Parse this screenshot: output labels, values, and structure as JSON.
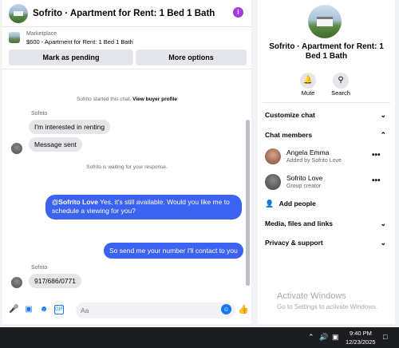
{
  "chat": {
    "title": "Sofrito · Apartment for Rent: 1 Bed 1 Bath",
    "info_icon": "i",
    "listing": {
      "label": "Marketplace",
      "price_title": "$600 - Apartment for Rent: 1 Bed 1 Bath",
      "mark_pending": "Mark as pending",
      "more_options": "More options"
    },
    "started_text": "Sofrito started this chat.",
    "view_profile": "View buyer profile",
    "sender_name_1": "Sofrito",
    "msg_1": "I'm interested in renting",
    "msg_2": "Message sent",
    "waiting_text": "Sofrito is waiting for your response.",
    "reply_mention": "@Sofrito Love",
    "reply_text": " Yes, it's still available. Would you like me to schedule a viewing for you?",
    "reply_2": "So send me your number I'll contact to you",
    "sender_name_2": "Sofrito",
    "msg_3": "917/686/0771",
    "input_placeholder": "Aa",
    "icons": [
      "microphone-icon",
      "photo-icon",
      "sticker-icon",
      "gif-icon",
      "emoji-icon",
      "like-icon"
    ]
  },
  "side": {
    "title": "Sofrito · Apartment for Rent: 1 Bed 1 Bath",
    "mute": "Mute",
    "search": "Search",
    "customize": "Customize chat",
    "members_header": "Chat members",
    "members": [
      {
        "name": "Angela Emma",
        "sub": "Added by Sofrito Love"
      },
      {
        "name": "Sofrito Love",
        "sub": "Group creator"
      }
    ],
    "add_people": "Add people",
    "media": "Media, files and links",
    "privacy": "Privacy & support"
  },
  "watermark": {
    "title": "Activate Windows",
    "sub": "Go to Settings to activate Windows."
  },
  "taskbar": {
    "time": "9:40 PM",
    "date": "12/23/2025"
  },
  "colors": {
    "accent": "#3b62f0",
    "messenger_blue": "#1877f2",
    "info_purple": "#a33be0"
  }
}
